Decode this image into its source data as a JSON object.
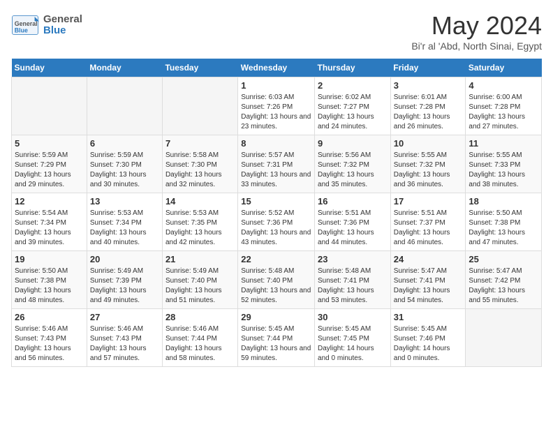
{
  "header": {
    "logo_general": "General",
    "logo_blue": "Blue",
    "month": "May 2024",
    "location": "Bi'r al 'Abd, North Sinai, Egypt"
  },
  "days_of_week": [
    "Sunday",
    "Monday",
    "Tuesday",
    "Wednesday",
    "Thursday",
    "Friday",
    "Saturday"
  ],
  "weeks": [
    [
      {
        "num": "",
        "info": ""
      },
      {
        "num": "",
        "info": ""
      },
      {
        "num": "",
        "info": ""
      },
      {
        "num": "1",
        "info": "Sunrise: 6:03 AM\nSunset: 7:26 PM\nDaylight: 13 hours and 23 minutes."
      },
      {
        "num": "2",
        "info": "Sunrise: 6:02 AM\nSunset: 7:27 PM\nDaylight: 13 hours and 24 minutes."
      },
      {
        "num": "3",
        "info": "Sunrise: 6:01 AM\nSunset: 7:28 PM\nDaylight: 13 hours and 26 minutes."
      },
      {
        "num": "4",
        "info": "Sunrise: 6:00 AM\nSunset: 7:28 PM\nDaylight: 13 hours and 27 minutes."
      }
    ],
    [
      {
        "num": "5",
        "info": "Sunrise: 5:59 AM\nSunset: 7:29 PM\nDaylight: 13 hours and 29 minutes."
      },
      {
        "num": "6",
        "info": "Sunrise: 5:59 AM\nSunset: 7:30 PM\nDaylight: 13 hours and 30 minutes."
      },
      {
        "num": "7",
        "info": "Sunrise: 5:58 AM\nSunset: 7:30 PM\nDaylight: 13 hours and 32 minutes."
      },
      {
        "num": "8",
        "info": "Sunrise: 5:57 AM\nSunset: 7:31 PM\nDaylight: 13 hours and 33 minutes."
      },
      {
        "num": "9",
        "info": "Sunrise: 5:56 AM\nSunset: 7:32 PM\nDaylight: 13 hours and 35 minutes."
      },
      {
        "num": "10",
        "info": "Sunrise: 5:55 AM\nSunset: 7:32 PM\nDaylight: 13 hours and 36 minutes."
      },
      {
        "num": "11",
        "info": "Sunrise: 5:55 AM\nSunset: 7:33 PM\nDaylight: 13 hours and 38 minutes."
      }
    ],
    [
      {
        "num": "12",
        "info": "Sunrise: 5:54 AM\nSunset: 7:34 PM\nDaylight: 13 hours and 39 minutes."
      },
      {
        "num": "13",
        "info": "Sunrise: 5:53 AM\nSunset: 7:34 PM\nDaylight: 13 hours and 40 minutes."
      },
      {
        "num": "14",
        "info": "Sunrise: 5:53 AM\nSunset: 7:35 PM\nDaylight: 13 hours and 42 minutes."
      },
      {
        "num": "15",
        "info": "Sunrise: 5:52 AM\nSunset: 7:36 PM\nDaylight: 13 hours and 43 minutes."
      },
      {
        "num": "16",
        "info": "Sunrise: 5:51 AM\nSunset: 7:36 PM\nDaylight: 13 hours and 44 minutes."
      },
      {
        "num": "17",
        "info": "Sunrise: 5:51 AM\nSunset: 7:37 PM\nDaylight: 13 hours and 46 minutes."
      },
      {
        "num": "18",
        "info": "Sunrise: 5:50 AM\nSunset: 7:38 PM\nDaylight: 13 hours and 47 minutes."
      }
    ],
    [
      {
        "num": "19",
        "info": "Sunrise: 5:50 AM\nSunset: 7:38 PM\nDaylight: 13 hours and 48 minutes."
      },
      {
        "num": "20",
        "info": "Sunrise: 5:49 AM\nSunset: 7:39 PM\nDaylight: 13 hours and 49 minutes."
      },
      {
        "num": "21",
        "info": "Sunrise: 5:49 AM\nSunset: 7:40 PM\nDaylight: 13 hours and 51 minutes."
      },
      {
        "num": "22",
        "info": "Sunrise: 5:48 AM\nSunset: 7:40 PM\nDaylight: 13 hours and 52 minutes."
      },
      {
        "num": "23",
        "info": "Sunrise: 5:48 AM\nSunset: 7:41 PM\nDaylight: 13 hours and 53 minutes."
      },
      {
        "num": "24",
        "info": "Sunrise: 5:47 AM\nSunset: 7:41 PM\nDaylight: 13 hours and 54 minutes."
      },
      {
        "num": "25",
        "info": "Sunrise: 5:47 AM\nSunset: 7:42 PM\nDaylight: 13 hours and 55 minutes."
      }
    ],
    [
      {
        "num": "26",
        "info": "Sunrise: 5:46 AM\nSunset: 7:43 PM\nDaylight: 13 hours and 56 minutes."
      },
      {
        "num": "27",
        "info": "Sunrise: 5:46 AM\nSunset: 7:43 PM\nDaylight: 13 hours and 57 minutes."
      },
      {
        "num": "28",
        "info": "Sunrise: 5:46 AM\nSunset: 7:44 PM\nDaylight: 13 hours and 58 minutes."
      },
      {
        "num": "29",
        "info": "Sunrise: 5:45 AM\nSunset: 7:44 PM\nDaylight: 13 hours and 59 minutes."
      },
      {
        "num": "30",
        "info": "Sunrise: 5:45 AM\nSunset: 7:45 PM\nDaylight: 14 hours and 0 minutes."
      },
      {
        "num": "31",
        "info": "Sunrise: 5:45 AM\nSunset: 7:46 PM\nDaylight: 14 hours and 0 minutes."
      },
      {
        "num": "",
        "info": ""
      }
    ]
  ]
}
